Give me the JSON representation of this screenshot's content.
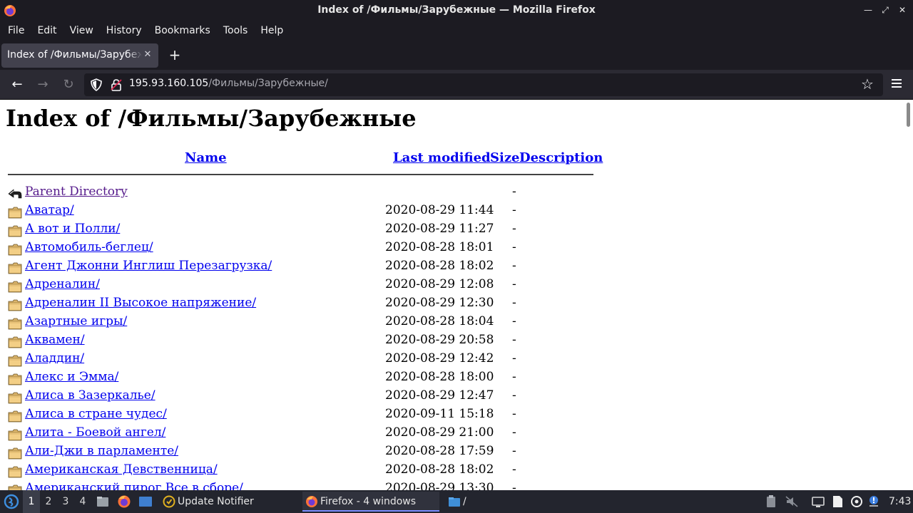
{
  "window": {
    "title": "Index of /Фильмы/Зарубежные — Mozilla Firefox",
    "buttons": [
      "minimize",
      "maximize",
      "close"
    ]
  },
  "menubar": {
    "items": [
      {
        "label": "File"
      },
      {
        "label": "Edit"
      },
      {
        "label": "View"
      },
      {
        "label": "History"
      },
      {
        "label": "Bookmarks"
      },
      {
        "label": "Tools"
      },
      {
        "label": "Help"
      }
    ]
  },
  "tabs": [
    {
      "title": "Index of /Фильмы/Зарубежные",
      "active": true
    }
  ],
  "navbar": {
    "url_host": "195.93.160.105",
    "url_path": "/Фильмы/Зарубежные/"
  },
  "page": {
    "heading": "Index of /Фильмы/Зарубежные",
    "columns": {
      "name": "Name",
      "last_modified": "Last modified",
      "size": "Size",
      "description": "Description"
    },
    "parent": {
      "name": "Parent Directory",
      "size": "-"
    },
    "rows": [
      {
        "name": "Аватар/",
        "date": "2020-08-29 11:44",
        "size": "-"
      },
      {
        "name": "А вот и Полли/",
        "date": "2020-08-29 11:27",
        "size": "-"
      },
      {
        "name": "Автомобиль-беглец/",
        "date": "2020-08-28 18:01",
        "size": "-"
      },
      {
        "name": "Агент Джонни Инглиш Перезагрузка/",
        "date": "2020-08-28 18:02",
        "size": "-"
      },
      {
        "name": "Адреналин/",
        "date": "2020-08-29 12:08",
        "size": "-"
      },
      {
        "name": "Адреналин II Высокое напряжение/",
        "date": "2020-08-29 12:30",
        "size": "-"
      },
      {
        "name": "Азартные игры/",
        "date": "2020-08-28 18:04",
        "size": "-"
      },
      {
        "name": "Аквамен/",
        "date": "2020-08-29 20:58",
        "size": "-"
      },
      {
        "name": "Аладдин/",
        "date": "2020-08-29 12:42",
        "size": "-"
      },
      {
        "name": "Алекс и Эмма/",
        "date": "2020-08-28 18:00",
        "size": "-"
      },
      {
        "name": "Алиса в Зазеркалье/",
        "date": "2020-08-29 12:47",
        "size": "-"
      },
      {
        "name": "Алиса в стране чудес/",
        "date": "2020-09-11 15:18",
        "size": "-"
      },
      {
        "name": "Алита - Боевой ангел/",
        "date": "2020-08-29 21:00",
        "size": "-"
      },
      {
        "name": "Али-Джи в парламенте/",
        "date": "2020-08-28 17:59",
        "size": "-"
      },
      {
        "name": "Американская Девственница/",
        "date": "2020-08-28 18:02",
        "size": "-"
      },
      {
        "name": "Американский пирог Все в сборе/",
        "date": "2020-08-29 13:30",
        "size": "-"
      }
    ]
  },
  "taskbar": {
    "workspaces": [
      "1",
      "2",
      "3",
      "4"
    ],
    "active_workspace": "1",
    "tasks": [
      {
        "label": "Update Notifier",
        "icon": "update-notifier-icon"
      },
      {
        "label": "Firefox - 4 windows",
        "icon": "firefox-icon",
        "active": true
      },
      {
        "label": "/",
        "icon": "folder-icon"
      }
    ],
    "clock": "7:43"
  },
  "colors": {
    "chrome_dark": "#1c1b22",
    "toolbar": "#2b2a33",
    "link": "#0000ee",
    "visited": "#551a8b",
    "taskbar": "#23252e"
  }
}
